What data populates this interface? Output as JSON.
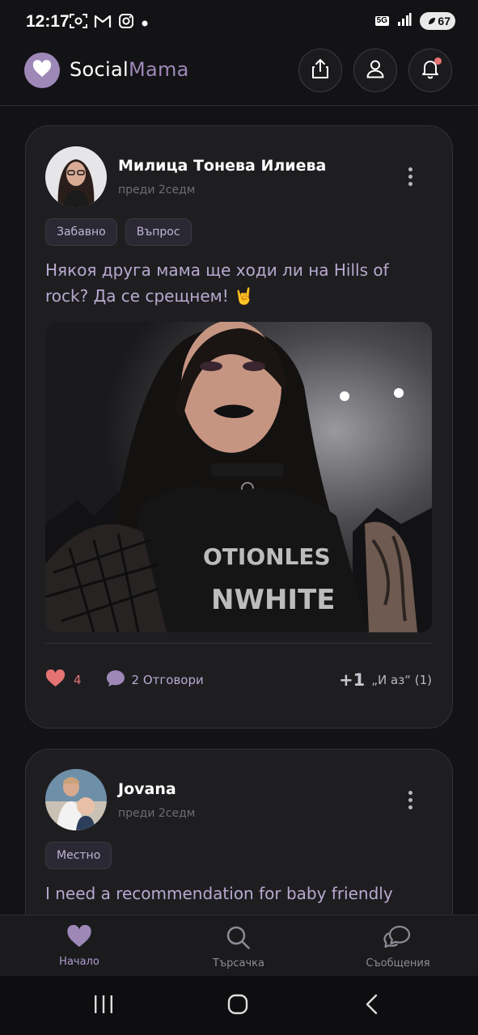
{
  "status_bar": {
    "time": "12:17",
    "network": "5G",
    "battery": "67"
  },
  "header": {
    "brand_social": "Social",
    "brand_mama": "Mama",
    "accent": "#9d88b8"
  },
  "posts": [
    {
      "author": "Милица Тонева Илиева",
      "time": "преди 2седм",
      "tags": [
        "Забавно",
        "Въпрос"
      ],
      "text": "Някоя друга мама ще ходи ли на Hills of rock? Да се срещнем! 🤘",
      "likes": "4",
      "replies": "2 Отговори",
      "me_too_icon": "+1",
      "me_too": "„И аз“ (1)"
    },
    {
      "author": "Jovana",
      "time": "преди 2седм",
      "tags": [
        "Местно"
      ],
      "text": "I need a recommendation for baby friendly"
    }
  ],
  "bottom_nav": {
    "items": [
      {
        "label": "Начало",
        "icon": "heart-icon",
        "active": true
      },
      {
        "label": "Търсачка",
        "icon": "search-icon",
        "active": false
      },
      {
        "label": "Съобщения",
        "icon": "chat-icon",
        "active": false
      }
    ]
  },
  "colors": {
    "background": "#131315",
    "card": "#1e1e21",
    "like": "#e57373",
    "tag_text": "#c0b4d4",
    "post_text": "#b8a9cf"
  }
}
